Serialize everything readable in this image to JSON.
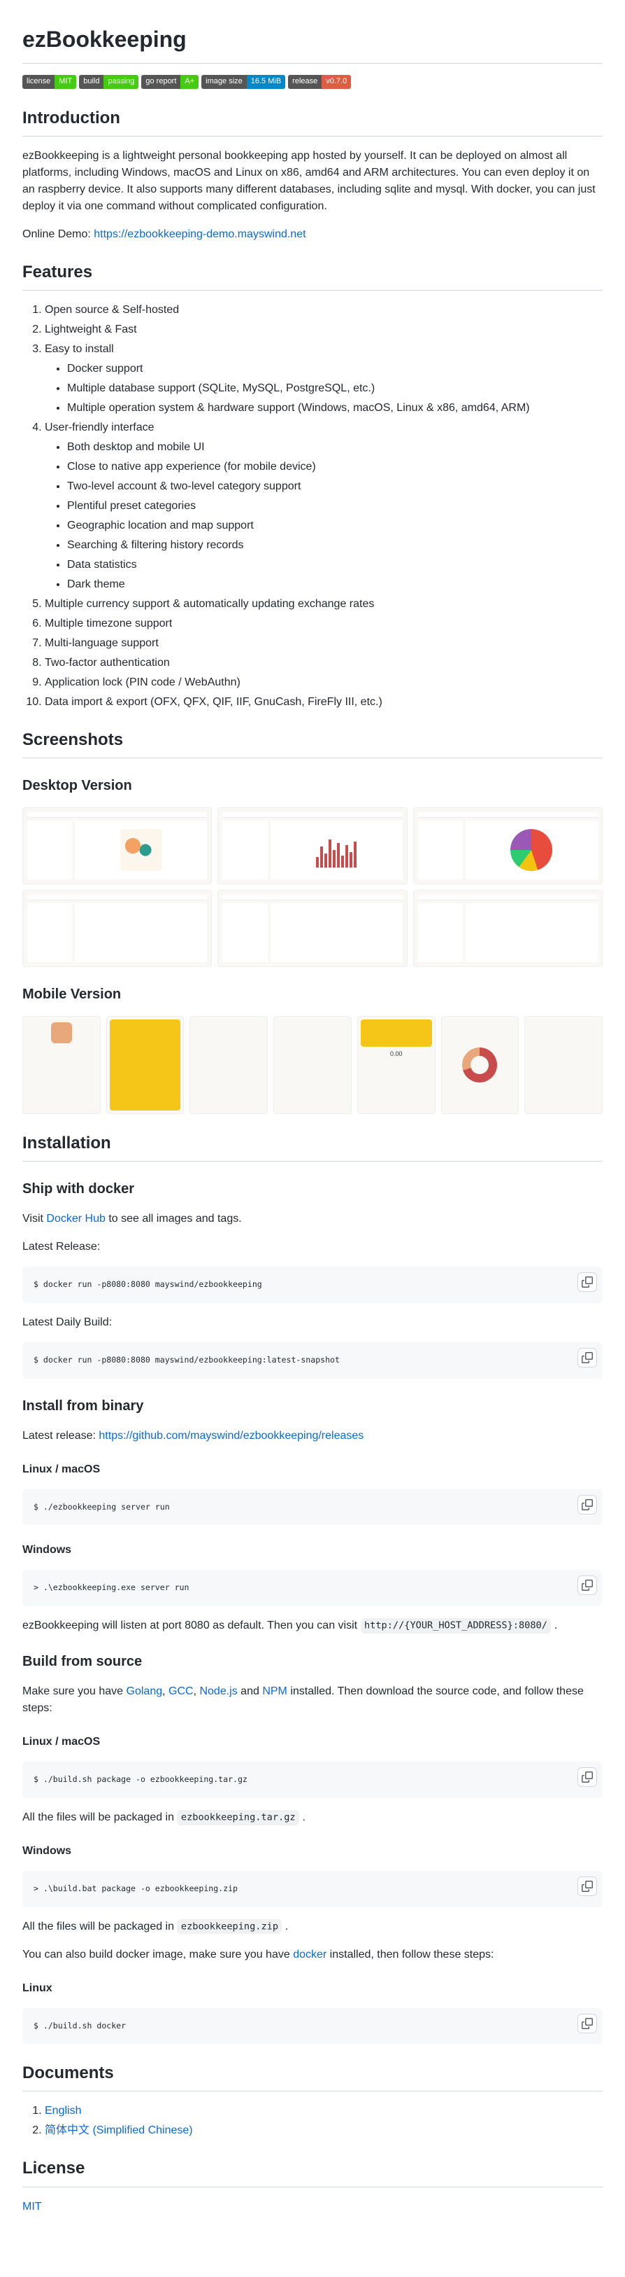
{
  "title": "ezBookkeeping",
  "badges": [
    {
      "k": "license",
      "v": "MIT",
      "c": "#4c1"
    },
    {
      "k": "build",
      "v": "passing",
      "c": "#4c1"
    },
    {
      "k": "go report",
      "v": "A+",
      "c": "#4c1"
    },
    {
      "k": "image size",
      "v": "16.5 MiB",
      "c": "#08c"
    },
    {
      "k": "release",
      "v": "v0.7.0",
      "c": "#e05d44"
    }
  ],
  "intro": {
    "heading": "Introduction",
    "text": "ezBookkeeping is a lightweight personal bookkeeping app hosted by yourself. It can be deployed on almost all platforms, including Windows, macOS and Linux on x86, amd64 and ARM architectures. You can even deploy it on an raspberry device. It also supports many different databases, including sqlite and mysql. With docker, you can just deploy it via one command without complicated configuration.",
    "demo_label": "Online Demo: ",
    "demo_link": "https://ezbookkeeping-demo.mayswind.net"
  },
  "features": {
    "heading": "Features",
    "item1": "Open source & Self-hosted",
    "item2": "Lightweight & Fast",
    "item3": "Easy to install",
    "item3a": "Docker support",
    "item3b": "Multiple database support (SQLite, MySQL, PostgreSQL, etc.)",
    "item3c": "Multiple operation system & hardware support (Windows, macOS, Linux & x86, amd64, ARM)",
    "item4": "User-friendly interface",
    "item4a": "Both desktop and mobile UI",
    "item4b": "Close to native app experience (for mobile device)",
    "item4c": "Two-level account & two-level category support",
    "item4d": "Plentiful preset categories",
    "item4e": "Geographic location and map support",
    "item4f": "Searching & filtering history records",
    "item4g": "Data statistics",
    "item4h": "Dark theme",
    "item5": "Multiple currency support & automatically updating exchange rates",
    "item6": "Multiple timezone support",
    "item7": "Multi-language support",
    "item8": "Two-factor authentication",
    "item9": "Application lock (PIN code / WebAuthn)",
    "item10": "Data import & export (OFX, QFX, QIF, IIF, GnuCash, FireFly III, etc.)"
  },
  "screenshots": {
    "heading": "Screenshots",
    "desktop": "Desktop Version",
    "mobile": "Mobile Version"
  },
  "install": {
    "heading": "Installation",
    "docker": {
      "heading": "Ship with docker",
      "visit1": "Visit ",
      "hub_link": "Docker Hub",
      "visit2": " to see all images and tags.",
      "latest_release": "Latest Release:",
      "cmd1": "$ docker run -p8080:8080 mayswind/ezbookkeeping",
      "latest_daily": "Latest Daily Build:",
      "cmd2": "$ docker run -p8080:8080 mayswind/ezbookkeeping:latest-snapshot"
    },
    "binary": {
      "heading": "Install from binary",
      "latest1": "Latest release: ",
      "link": "https://github.com/mayswind/ezbookkeeping/releases",
      "linux_macos": "Linux / macOS",
      "cmd_linux": "$ ./ezbookkeeping server run",
      "windows": "Windows",
      "cmd_win": "> .\\ezbookkeeping.exe server run",
      "listen1": "ezBookkeeping will listen at port 8080 as default. Then you can visit ",
      "listen_code": "http://{YOUR_HOST_ADDRESS}:8080/",
      "listen2": " ."
    },
    "source": {
      "heading": "Build from source",
      "make1": "Make sure you have ",
      "golang": "Golang",
      "c1": ", ",
      "gcc": "GCC",
      "c2": ", ",
      "node": "Node.js",
      "c3": " and ",
      "npm": "NPM",
      "make2": " installed. Then download the source code, and follow these steps:",
      "linux_macos": "Linux / macOS",
      "cmd_linux": "$ ./build.sh package -o ezbookkeeping.tar.gz",
      "pkg_linux1": "All the files will be packaged in ",
      "pkg_linux_code": "ezbookkeeping.tar.gz",
      "pkg_linux2": " .",
      "windows": "Windows",
      "cmd_win": "> .\\build.bat package -o ezbookkeeping.zip",
      "pkg_win1": "All the files will be packaged in ",
      "pkg_win_code": "ezbookkeeping.zip",
      "pkg_win2": " .",
      "docker1": "You can also build docker image, make sure you have ",
      "docker_link": "docker",
      "docker2": " installed, then follow these steps:",
      "linux": "Linux",
      "cmd_docker": "$ ./build.sh docker"
    }
  },
  "docs": {
    "heading": "Documents",
    "en": "English",
    "zh": "简体中文 (Simplified Chinese)"
  },
  "license": {
    "heading": "License",
    "link": "MIT"
  }
}
